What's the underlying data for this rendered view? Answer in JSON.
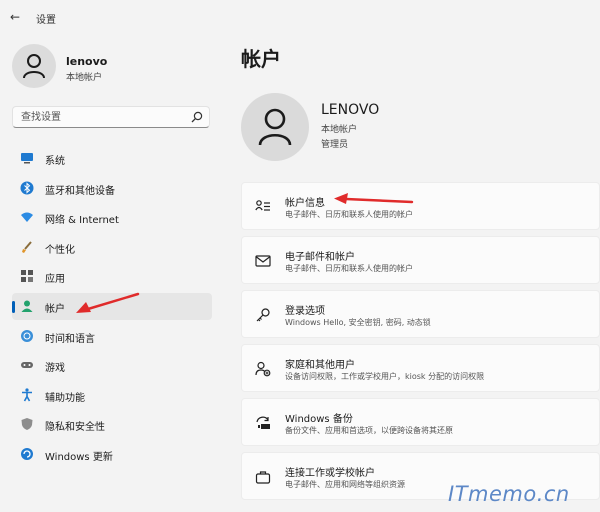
{
  "window": {
    "title": "设置"
  },
  "profile": {
    "name": "lenovo",
    "type": "本地帐户"
  },
  "search": {
    "placeholder": "查找设置"
  },
  "sidebar": {
    "items": [
      {
        "label": "系统",
        "icon": "monitor-icon"
      },
      {
        "label": "蓝牙和其他设备",
        "icon": "bluetooth-icon"
      },
      {
        "label": "网络 & Internet",
        "icon": "wifi-icon"
      },
      {
        "label": "个性化",
        "icon": "brush-icon"
      },
      {
        "label": "应用",
        "icon": "apps-icon"
      },
      {
        "label": "帐户",
        "icon": "person-icon",
        "selected": true
      },
      {
        "label": "时间和语言",
        "icon": "globe-clock-icon"
      },
      {
        "label": "游戏",
        "icon": "gamepad-icon"
      },
      {
        "label": "辅助功能",
        "icon": "accessibility-icon"
      },
      {
        "label": "隐私和安全性",
        "icon": "shield-icon"
      },
      {
        "label": "Windows 更新",
        "icon": "update-icon"
      }
    ]
  },
  "main": {
    "title": "帐户",
    "account": {
      "name": "LENOVO",
      "type": "本地帐户",
      "role": "管理员"
    },
    "cards": [
      {
        "title": "帐户信息",
        "subtitle": "电子邮件、日历和联系人使用的帐户",
        "icon": "account-info-icon"
      },
      {
        "title": "电子邮件和帐户",
        "subtitle": "电子邮件、日历和联系人使用的帐户",
        "icon": "mail-icon"
      },
      {
        "title": "登录选项",
        "subtitle": "Windows Hello, 安全密钥, 密码, 动态锁",
        "icon": "key-icon"
      },
      {
        "title": "家庭和其他用户",
        "subtitle": "设备访问权限，工作或学校用户，kiosk 分配的访问权限",
        "icon": "family-icon"
      },
      {
        "title": "Windows 备份",
        "subtitle": "备份文件、应用和首选项，以便跨设备将其还原",
        "icon": "backup-icon"
      },
      {
        "title": "连接工作或学校帐户",
        "subtitle": "电子邮件、应用和网络等组织资源",
        "icon": "briefcase-icon"
      }
    ]
  },
  "colors": {
    "accent": "#005fb8",
    "annotation_arrow": "#e02b2b",
    "watermark": "#5d88c7"
  },
  "watermark": "ITmemo.cn"
}
